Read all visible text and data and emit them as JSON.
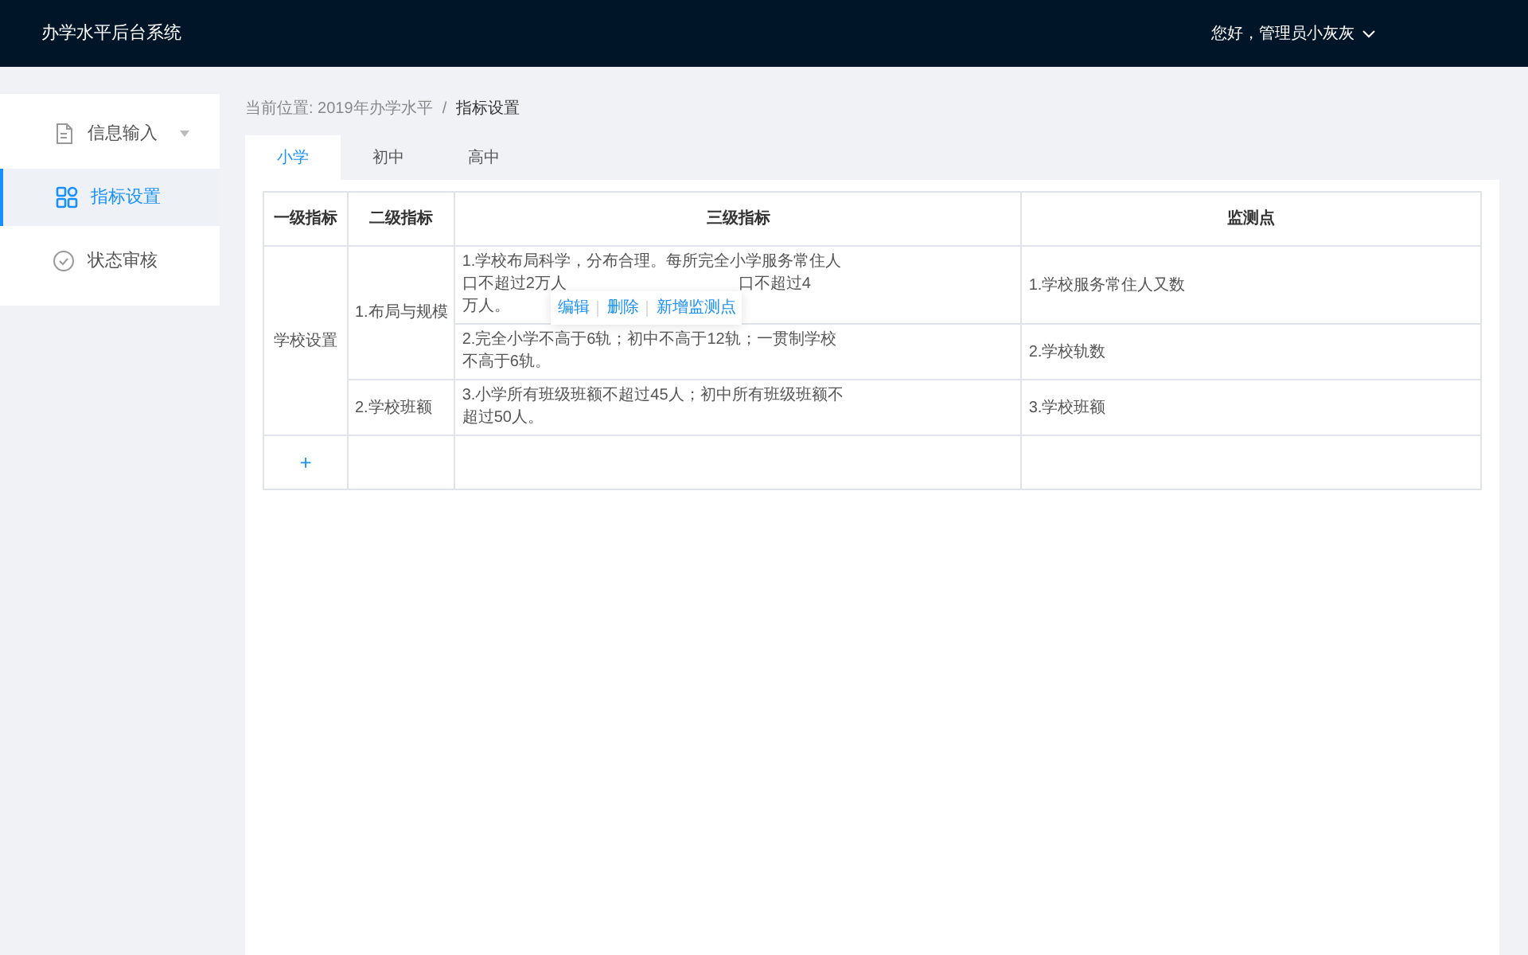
{
  "header": {
    "title": "办学水平后台系统",
    "user": "您好，管理员小灰灰"
  },
  "sidebar": {
    "items": [
      {
        "label": "信息输入",
        "kind": "document",
        "selected": false,
        "has_submenu": true
      },
      {
        "label": "指标设置",
        "kind": "grid",
        "selected": true,
        "has_submenu": false
      },
      {
        "label": "状态审核",
        "kind": "check",
        "selected": false,
        "has_submenu": false
      }
    ]
  },
  "breadcrumb": {
    "prefix": "当前位置: 2019年办学水平",
    "separator": "/",
    "current": "指标设置"
  },
  "tabs": [
    {
      "label": "小学",
      "selected": true
    },
    {
      "label": "初中",
      "selected": false
    },
    {
      "label": "高中",
      "selected": false
    }
  ],
  "table": {
    "columns": [
      "一级指标",
      "二级指标",
      "三级指标",
      "监测点"
    ],
    "groups": [
      {
        "level1": "学校设置",
        "children": [
          {
            "level2": "1.布局与规模",
            "rows": [
              {
                "lines": [
                  [
                    "1.学校布局科学，分布合理。每所完全小学服务常住人"
                  ],
                  [
                    "口不超过2万人",
                    "口不超过4"
                  ],
                  [
                    "万人。"
                  ]
                ],
                "point": "1.学校服务常住人又数",
                "actions": [
                  "编辑",
                  "删除",
                  "新增监测点"
                ]
              },
              {
                "lines": [
                  [
                    "2.完全小学不高于6轨；初中不高于12轨；一贯制学校"
                  ],
                  [
                    "不高于6轨。"
                  ]
                ],
                "point": "2.学校轨数"
              }
            ]
          },
          {
            "level2": "2.学校班额",
            "rows": [
              {
                "lines": [
                  [
                    "3.小学所有班级班额不超过45人；初中所有班级班额不"
                  ],
                  [
                    "超过50人。"
                  ]
                ],
                "point": "3.学校班额"
              }
            ]
          }
        ]
      }
    ],
    "add_label": "+"
  }
}
